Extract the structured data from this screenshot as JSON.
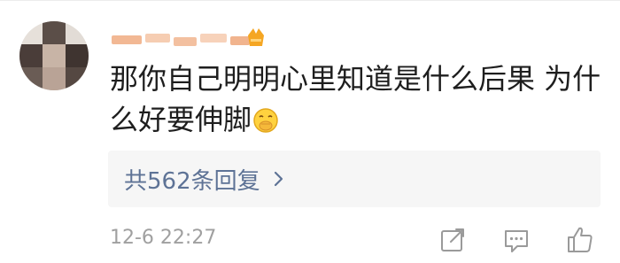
{
  "comment": {
    "text": "那你自己明明心里知道是什么后果 为什么好要伸脚",
    "emoji": "face-with-hand-over-mouth-emoji"
  },
  "replies": {
    "label": "共562条回复",
    "chevron": "chevron-right-icon"
  },
  "meta": {
    "timestamp": "12-6 22:27"
  },
  "actions": [
    {
      "name": "share-icon"
    },
    {
      "name": "comment-icon"
    },
    {
      "name": "like-icon"
    }
  ],
  "colors": {
    "comment_text": "#1e1e1e",
    "link_text": "#5e7396",
    "reply_box_bg": "#f6f6f6",
    "meta_text": "#a0a0a0",
    "badge": "#f5a623"
  }
}
